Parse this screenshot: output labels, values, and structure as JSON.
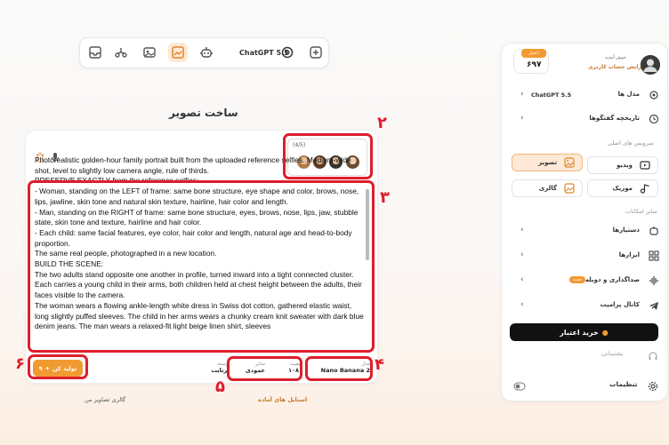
{
  "toolbar": {
    "model": "ChatGPT 5.5",
    "icons": [
      "add-icon",
      "chatgpt-icon",
      "robot-icon",
      "image-edit-icon",
      "gallery-icon",
      "flow-icon",
      "inbox-icon"
    ]
  },
  "page_title": "ساخت تصویر",
  "references": {
    "count_label": "(4/5)"
  },
  "prompt_lines": [
    "Photorealistic golden-hour family portrait built from the uploaded reference selfies. Medium-wide shot, level to slightly low camera angle, rule of thirds.",
    "PRESERVE EXACTLY from the reference selfies:",
    "- Woman, standing on the LEFT of frame: same bone structure, eye shape and color, brows, nose, lips, jawline, skin tone and natural skin texture, hairline, hair color and length.",
    "- Man, standing on the RIGHT of frame: same bone structure, eyes, brows, nose, lips, jaw, stubble state, skin tone and texture, hairline and hair color.",
    "- Each child: same facial features, eye color, hair color and length, natural age and head-to-body proportion.",
    "The same real people, photographed in a new location.",
    "BUILD THE SCENE:",
    "The two adults stand opposite one another in profile, turned inward into a tight connected cluster. Each carries a young child in their arms, both children held at chest height between the adults, their faces visible to the camera.",
    "The woman wears a flowing ankle-length white dress in Swiss dot cotton, gathered elastic waist, long slightly puffed sleeves. The child in her arms wears a chunky cream knit sweater with dark blue denim jeans. The man wears a relaxed-fit light beige linen shirt, sleeves"
  ],
  "generate": {
    "label": "تولید کن",
    "cost": "۹"
  },
  "options": {
    "model_label": "مدل",
    "model_value": "Nano Banana 2",
    "quality_label": "کیفیت",
    "quality_value": "۱۰۸۰",
    "size_label": "سایز",
    "size_value": "عمودی",
    "aspect_label": "پوسته",
    "aspect_value": "پرتابت"
  },
  "links": {
    "styles": "استایل های آماده",
    "gallery": "گالری تصاویر من"
  },
  "annotations": [
    "۱",
    "۲",
    "۳",
    "۴",
    "۵",
    "۶"
  ],
  "sidebar": {
    "credit_badge": "اعتبار",
    "credit_value": "۶۹۷",
    "welcome": "خوش آمدید",
    "profile_link": "ویرایش حساب کاربری",
    "model_row": {
      "label": "مدل ها",
      "value": "ChatGPT 5.5"
    },
    "history_row": "تاریخچه گفتگوها",
    "main_services_title": "سرویس های اصلی",
    "services": [
      {
        "label": "تصویر",
        "icon": "image-icon",
        "active": true
      },
      {
        "label": "ویدیو",
        "icon": "video-icon",
        "active": false
      },
      {
        "label": "گالری",
        "icon": "gallery-icon",
        "active": false
      },
      {
        "label": "موزیک",
        "icon": "music-icon",
        "active": false
      }
    ],
    "other_title": "سایر امکانات",
    "other_items": [
      {
        "label": "دستیارها",
        "icon": "assistant-icon"
      },
      {
        "label": "ابزارها",
        "icon": "tools-icon"
      },
      {
        "label": "صداگذاری و دوبله",
        "icon": "voice-icon",
        "badge": "جدید"
      },
      {
        "label": "کانال پرامپت",
        "icon": "telegram-icon"
      }
    ],
    "buy_label": "خرید اعتبار",
    "support": "پشتیبانی",
    "settings": "تنظیمات"
  },
  "colors": {
    "accent": "#f29a32",
    "annotation": "#dd1e2c",
    "dark": "#111111"
  }
}
